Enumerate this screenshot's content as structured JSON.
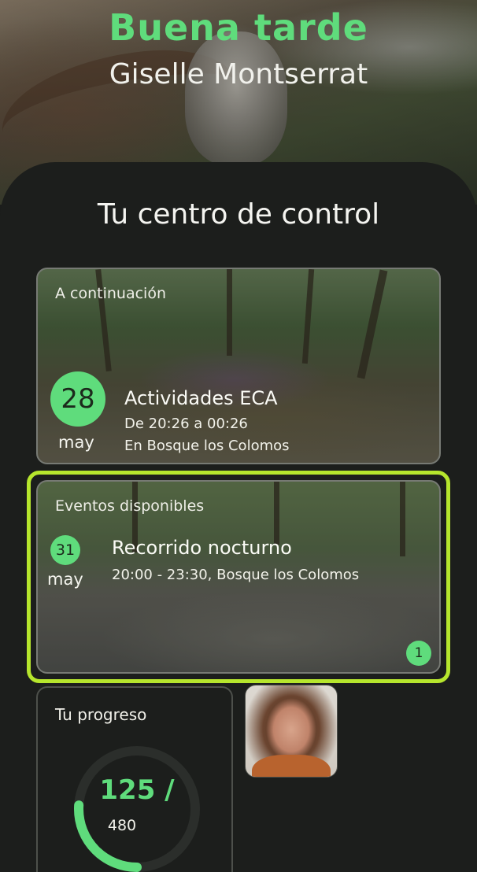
{
  "header": {
    "greeting": "Buena tarde",
    "user_name": "Giselle Montserrat"
  },
  "dashboard": {
    "title": "Tu centro de control"
  },
  "next_event": {
    "section_label": "A continuación",
    "day": "28",
    "month": "may",
    "title": "Actividades ECA",
    "time": "De 20:26 a 00:26",
    "location": "En Bosque los Colomos"
  },
  "available_events": {
    "section_label": "Eventos disponibles",
    "day": "31",
    "month": "may",
    "title": "Recorrido nocturno",
    "details": "20:00 - 23:30, Bosque los Colomos",
    "count_badge": "1"
  },
  "progress": {
    "label": "Tu progreso",
    "value_text": "125 /",
    "total_text": "480",
    "current": 125,
    "total": 480
  },
  "colors": {
    "accent": "#5fdc7c",
    "highlight_border": "#b6e62d",
    "panel_bg": "#1c1e1c"
  },
  "icons": {
    "avatar": "user-photo"
  }
}
